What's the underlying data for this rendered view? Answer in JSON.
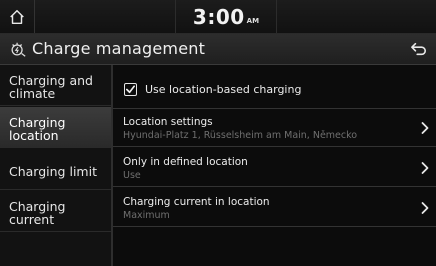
{
  "status": {
    "time": "3:00",
    "ampm": "AM"
  },
  "header": {
    "title": "Charge management",
    "icons": {
      "home": "home-icon",
      "title": "charge-management-icon",
      "back": "back-arrow-icon"
    }
  },
  "sidebar": {
    "items": [
      {
        "label": "Charging and\nclimate",
        "active": false
      },
      {
        "label": "Charging\nlocation",
        "active": true
      },
      {
        "label": "Charging limit",
        "active": false
      },
      {
        "label": "Charging\ncurrent",
        "active": false
      }
    ]
  },
  "main": {
    "checkbox": {
      "label": "Use location-based charging",
      "checked": true
    },
    "settings": [
      {
        "title": "Location settings",
        "value": "Hyundai-Platz 1, Rüsselsheim am Main, Německo"
      },
      {
        "title": "Only in defined location",
        "value": "Use"
      },
      {
        "title": "Charging current in location",
        "value": "Maximum"
      }
    ]
  },
  "colors": {
    "background": "#0c0c0c",
    "active_item": "#3c3c3c",
    "text": "#e8e8e8",
    "subtext": "#6f6f6f"
  }
}
